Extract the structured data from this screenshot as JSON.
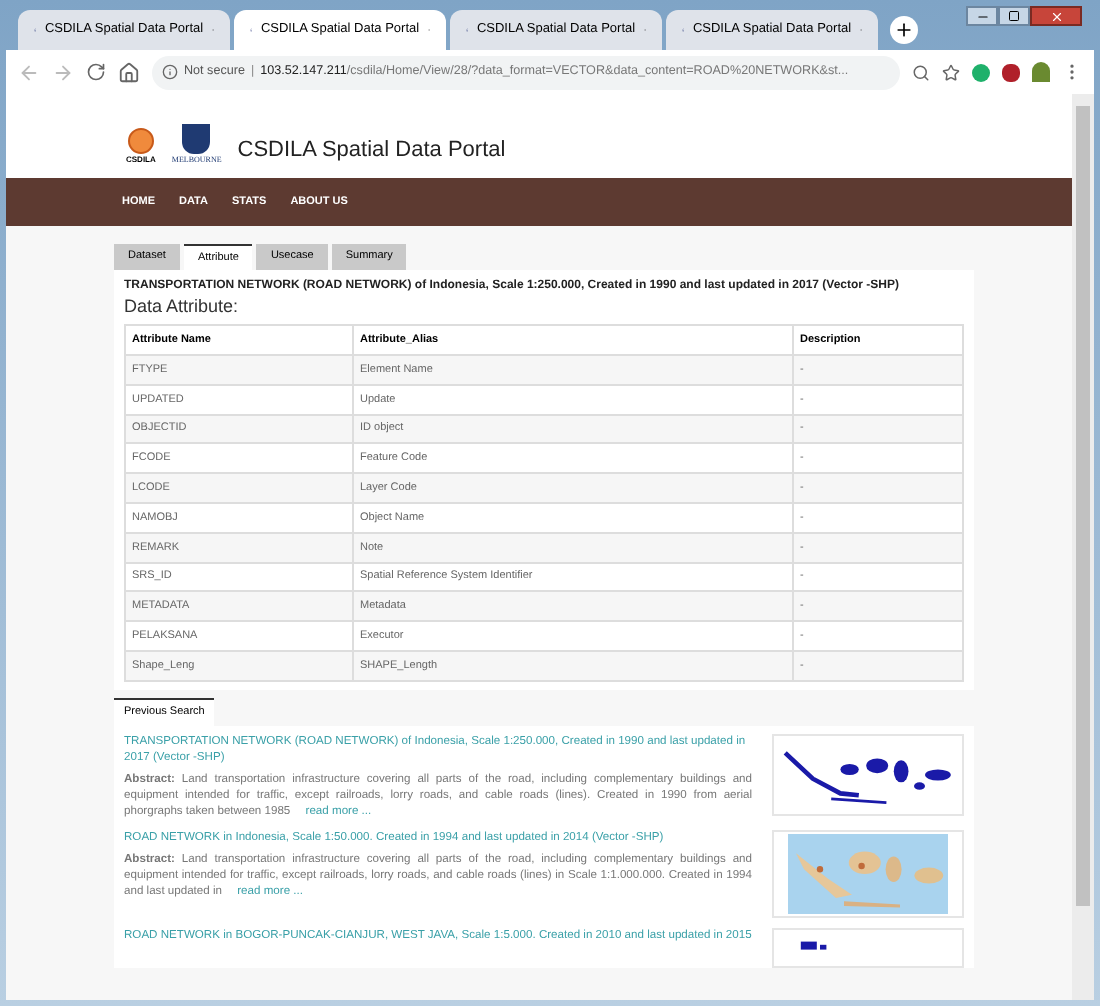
{
  "browser_tabs": [
    {
      "title": "CSDILA Spatial Data Portal",
      "selected": false
    },
    {
      "title": "CSDILA Spatial Data Portal",
      "selected": true
    },
    {
      "title": "CSDILA Spatial Data Portal",
      "selected": false
    },
    {
      "title": "CSDILA Spatial Data Portal",
      "selected": false
    }
  ],
  "address_bar": {
    "security": "Not secure",
    "separator": "|",
    "host": "103.52.147.211",
    "path": "/csdila/Home/View/28/?data_format=VECTOR&data_content=ROAD%20NETWORK&st..."
  },
  "header": {
    "logo_text": "CSDILA",
    "university": "MELBOURNE",
    "title": "CSDILA Spatial Data Portal"
  },
  "nav": [
    "HOME",
    "DATA",
    "STATS",
    "ABOUT US"
  ],
  "tabs": [
    {
      "label": "Dataset",
      "selected": false
    },
    {
      "label": "Attribute",
      "selected": true
    },
    {
      "label": "Usecase",
      "selected": false
    },
    {
      "label": "Summary",
      "selected": false
    }
  ],
  "dataset_title": "TRANSPORTATION NETWORK (ROAD NETWORK) of Indonesia, Scale 1:250.000, Created in 1990 and last updated in 2017 (Vector -SHP)",
  "section_heading": "Data Attribute:",
  "table": {
    "columns": [
      "Attribute Name",
      "Attribute_Alias",
      "Description"
    ],
    "rows": [
      [
        "FTYPE",
        "Element Name",
        "-"
      ],
      [
        "UPDATED",
        "Update",
        "-"
      ],
      [
        "OBJECTID",
        "ID object",
        "-"
      ],
      [
        "FCODE",
        "Feature Code",
        "-"
      ],
      [
        "LCODE",
        "Layer Code",
        "-"
      ],
      [
        "NAMOBJ",
        "Object Name",
        "-"
      ],
      [
        "REMARK",
        "Note",
        "-"
      ],
      [
        "SRS_ID",
        "Spatial Reference System Identifier",
        "-"
      ],
      [
        "METADATA",
        "Metadata",
        "-"
      ],
      [
        "PELAKSANA",
        "Executor",
        "-"
      ],
      [
        "Shape_Leng",
        "SHAPE_Length",
        "-"
      ]
    ]
  },
  "previous_search": {
    "tab": "Previous Search",
    "results": [
      {
        "title": "TRANSPORTATION NETWORK (ROAD NETWORK) of Indonesia, Scale 1:250.000, Created in 1990 and last updated in 2017 (Vector -SHP)",
        "abstract": "**Abstract:** Land transportation infrastructure covering all parts of the road, including complementary buildings and equipment intended for traffic, except railroads, lorry roads, and cable roads (lines). Created in 1990 from aerial phorgraphs taken between 1985",
        "read_more": "read more ...",
        "kind": "outline"
      },
      {
        "title": "ROAD NETWORK in Indonesia, Scale 1:50.000. Created in 1994 and last updated in 2014 (Vector -SHP)",
        "abstract": "**Abstract:** Land transportation infrastructure covering all parts of the road, including complementary buildings and equipment intended for traffic, except railroads, lorry roads, and cable roads (lines) in Scale 1:1.000.000. Created in 1994 and last updated in",
        "read_more": "read more ...",
        "kind": "map"
      },
      {
        "title": "ROAD NETWORK in BOGOR-PUNCAK-CIANJUR, WEST JAVA, Scale 1:5.000. Created in 2010 and last updated in 2015",
        "kind": "small"
      }
    ]
  }
}
